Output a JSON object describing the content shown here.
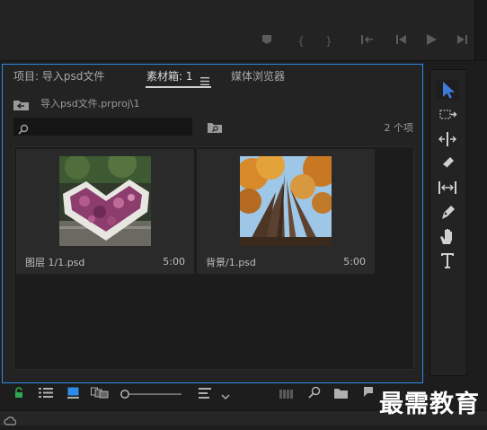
{
  "tabs": [
    {
      "label": "项目: 导入psd文件"
    },
    {
      "label": "素材箱: 1"
    },
    {
      "label": "媒体浏览器"
    }
  ],
  "tab_menu_icon": "hamburger-menu-icon",
  "path": {
    "text": "导入psd文件.prproj\\1"
  },
  "search": {
    "value": "",
    "placeholder": ""
  },
  "count": {
    "text": "2 个项"
  },
  "clips": [
    {
      "name": "图层 1/1.psd",
      "duration": "5:00"
    },
    {
      "name": "背景/1.psd",
      "duration": "5:00"
    }
  ],
  "watermark": {
    "text": "最需教育"
  },
  "colors": {
    "accent": "#2d8ceb",
    "panel": "#232323",
    "selected_tool": "#3d7bdc"
  }
}
